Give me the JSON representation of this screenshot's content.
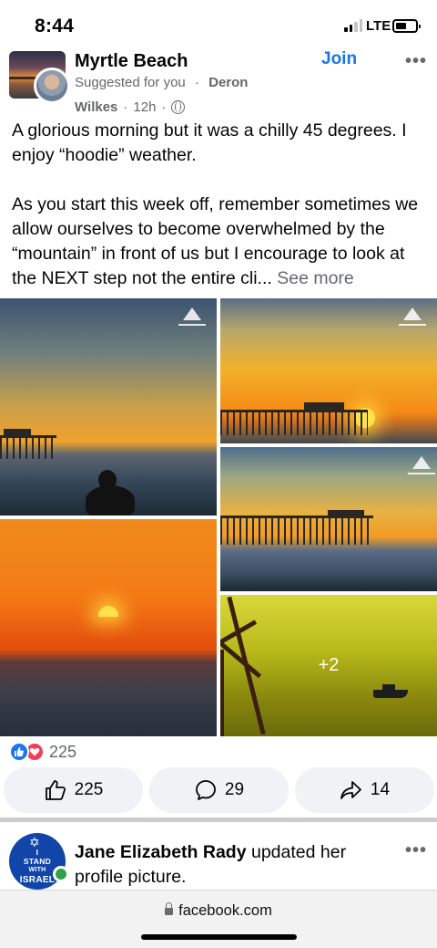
{
  "status_bar": {
    "time": "8:44",
    "network": "LTE"
  },
  "post": {
    "group_name": "Myrtle Beach",
    "join_label": "Join",
    "more_label": "•••",
    "suggested": "Suggested for you",
    "separator": "·",
    "author_first": "Deron",
    "author_last": "Wilkes",
    "time": "12h",
    "text_line1": "A glorious morning but it was a chilly 45 degrees. I enjoy “hoodie” weather.",
    "text_line2": "As you start this week off, remember sometimes we allow ourselves to become overwhelmed by the “mountain” in front of us but I encourage to look at the NEXT step not the entire cli...",
    "see_more": "See more",
    "more_photos": "+2"
  },
  "reactions": {
    "count": "225",
    "like_count": "225",
    "comment_count": "29",
    "share_count": "14"
  },
  "next_post": {
    "avatar_line1": "I",
    "avatar_line2": "STAND",
    "avatar_line3": "WITH",
    "avatar_line4": "ISRAEL",
    "name": "Jane Elizabeth Rady",
    "action": " updated her profile picture.",
    "more_label": "•••"
  },
  "browser": {
    "url": "facebook.com"
  },
  "colors": {
    "accent": "#1b74e4",
    "like": "#1877f2",
    "love": "#f33e58",
    "online": "#31a24c"
  }
}
